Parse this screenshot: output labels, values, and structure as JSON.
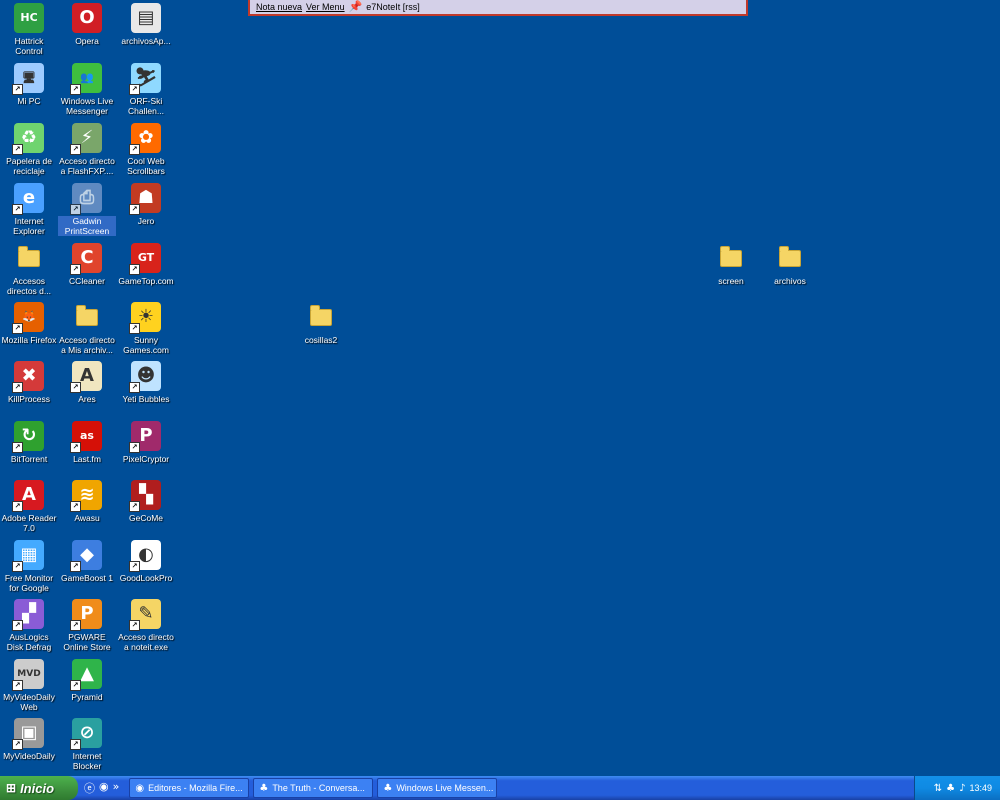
{
  "notebar": {
    "new_note": "Nota nueva",
    "view_menu": "Ver Menu",
    "title": "e7NoteIt [rss]"
  },
  "icons": [
    {
      "label": "Hattrick Control",
      "icon": "hattrick-icon",
      "color": "#2ea043",
      "glyph": "HC"
    },
    {
      "label": "Opera",
      "icon": "opera-icon",
      "color": "#d11e25",
      "glyph": "O"
    },
    {
      "label": "archivosAp...",
      "icon": "text-file-icon",
      "color": "#e8e8e8",
      "glyph": "▤"
    },
    {
      "label": "Mi PC",
      "icon": "my-computer-icon",
      "color": "#9ecbff",
      "glyph": "🖥"
    },
    {
      "label": "Windows Live Messenger",
      "icon": "messenger-icon",
      "color": "#3fbf3f",
      "glyph": "👥"
    },
    {
      "label": "ORF-Ski Challen...",
      "icon": "ski-icon",
      "color": "#8fd9ff",
      "glyph": "⛷"
    },
    {
      "label": "Papelera de reciclaje",
      "icon": "recycle-bin-icon",
      "color": "#6fd46f",
      "glyph": "♻"
    },
    {
      "label": "Acceso directo a FlashFXP....",
      "icon": "flashfxp-icon",
      "color": "#7aa66a",
      "glyph": "⚡"
    },
    {
      "label": "Cool Web Scrollbars",
      "icon": "scrollbars-icon",
      "color": "#ff6a00",
      "glyph": "✿"
    },
    {
      "label": "Internet Explorer",
      "icon": "ie-icon",
      "color": "#4aa0ff",
      "glyph": "e"
    },
    {
      "label": "Gadwin PrintScreen",
      "icon": "printscreen-icon",
      "color": "#7f9fcf",
      "glyph": "⎙"
    },
    {
      "label": "Jero",
      "icon": "jero-icon",
      "color": "#c23b22",
      "glyph": "☗"
    },
    {
      "label": "Accesos directos d...",
      "icon": "folder-icon",
      "color": "#f5d565",
      "glyph": "folder"
    },
    {
      "label": "CCleaner",
      "icon": "ccleaner-icon",
      "color": "#e0442c",
      "glyph": "C"
    },
    {
      "label": "GameTop.com",
      "icon": "gametop-icon",
      "color": "#d8231b",
      "glyph": "GT"
    },
    {
      "label": "Mozilla Firefox",
      "icon": "firefox-icon",
      "color": "#e66000",
      "glyph": "🦊"
    },
    {
      "label": "Acceso directo a Mis archiv...",
      "icon": "folder-icon",
      "color": "#f5d565",
      "glyph": "folder"
    },
    {
      "label": "Sunny Games.com",
      "icon": "sunny-games-icon",
      "color": "#ffd21f",
      "glyph": "☀"
    },
    {
      "label": "KillProcess",
      "icon": "killprocess-icon",
      "color": "#d43a3a",
      "glyph": "✖"
    },
    {
      "label": "Ares",
      "icon": "ares-icon",
      "color": "#f0e6c0",
      "glyph": "A"
    },
    {
      "label": "Yeti Bubbles",
      "icon": "yeti-icon",
      "color": "#bfe3ff",
      "glyph": "☻"
    },
    {
      "label": "BitTorrent",
      "icon": "bittorrent-icon",
      "color": "#2fa12f",
      "glyph": "↻"
    },
    {
      "label": "Last.fm",
      "icon": "lastfm-icon",
      "color": "#d51007",
      "glyph": "as"
    },
    {
      "label": "PixelCryptor",
      "icon": "pixelcryptor-icon",
      "color": "#a02a6b",
      "glyph": "P"
    },
    {
      "label": "Adobe Reader 7.0",
      "icon": "adobe-reader-icon",
      "color": "#d71920",
      "glyph": "A"
    },
    {
      "label": "Awasu",
      "icon": "awasu-icon",
      "color": "#f0a500",
      "glyph": "≋"
    },
    {
      "label": "GeCoMe",
      "icon": "gecome-icon",
      "color": "#b01e1e",
      "glyph": "▚"
    },
    {
      "label": "Free Monitor for Google",
      "icon": "free-monitor-icon",
      "color": "#44aaff",
      "glyph": "▦"
    },
    {
      "label": "GameBoost 1",
      "icon": "gameboost-icon",
      "color": "#3d7ee0",
      "glyph": "◆"
    },
    {
      "label": "GoodLookPro",
      "icon": "goodlook-icon",
      "color": "#ffffff",
      "glyph": "◐"
    },
    {
      "label": "AusLogics Disk Defrag",
      "icon": "defrag-icon",
      "color": "#8a5cd6",
      "glyph": "▞"
    },
    {
      "label": "PGWARE Online Store",
      "icon": "pgware-icon",
      "color": "#f08c1a",
      "glyph": "P"
    },
    {
      "label": "Acceso directo a noteit.exe",
      "icon": "noteit-icon",
      "color": "#f5d565",
      "glyph": "✎"
    },
    {
      "label": "MyVideoDaily Web",
      "icon": "myvideodaily-web-icon",
      "color": "#cccccc",
      "glyph": "MVD"
    },
    {
      "label": "Pyramid",
      "icon": "pyramid-icon",
      "color": "#2fb44a",
      "glyph": "▲"
    },
    {
      "label": "MyVideoDaily",
      "icon": "myvideodaily-icon",
      "color": "#999999",
      "glyph": "▣"
    },
    {
      "label": "Internet Blocker",
      "icon": "internet-blocker-icon",
      "color": "#2aa0a0",
      "glyph": "⊘"
    },
    {
      "label": "cosillas2",
      "icon": "folder-icon",
      "color": "#f5d565",
      "glyph": "folder"
    },
    {
      "label": "screen",
      "icon": "folder-icon",
      "color": "#f5d565",
      "glyph": "folder"
    },
    {
      "label": "archivos",
      "icon": "folder-icon",
      "color": "#f5d565",
      "glyph": "folder"
    }
  ],
  "taskbar": {
    "start_label": "Inicio",
    "tasks": [
      {
        "label": "Editores - Mozilla Fire...",
        "icon": "firefox-icon"
      },
      {
        "label": "The Truth - Conversa...",
        "icon": "messenger-icon"
      },
      {
        "label": "Windows Live Messen...",
        "icon": "messenger-icon"
      }
    ],
    "clock": "13:49"
  }
}
